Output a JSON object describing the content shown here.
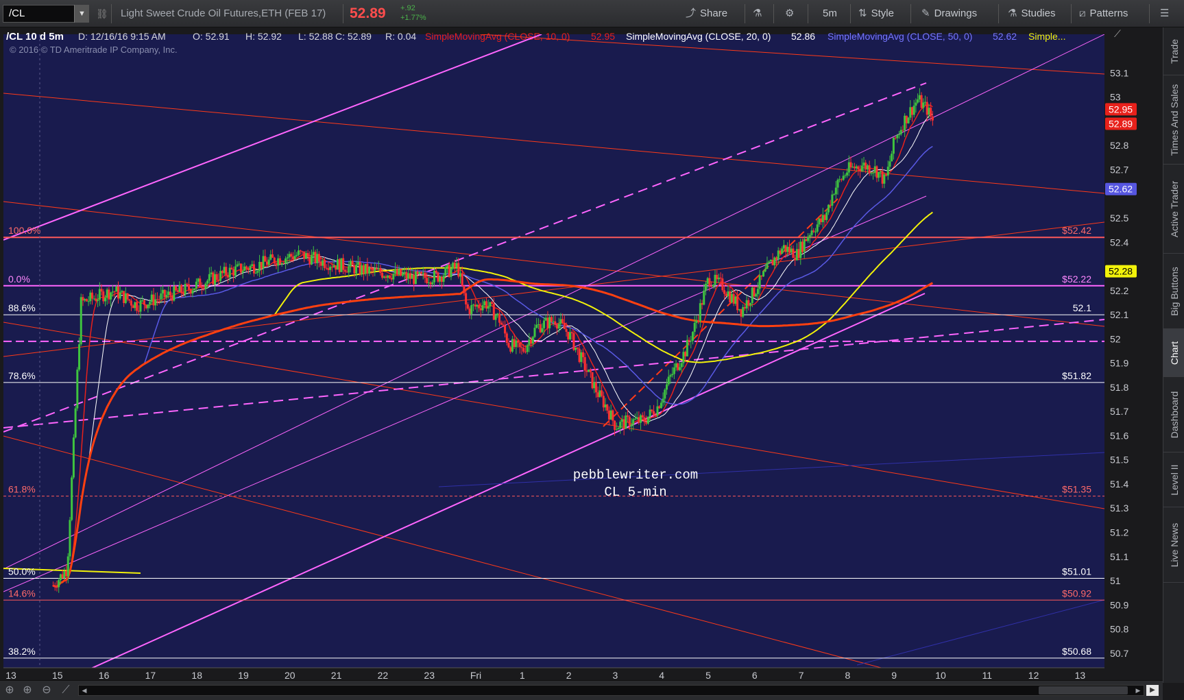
{
  "toolbar": {
    "symbol": "/CL",
    "instrument_name": "Light Sweet Crude Oil Futures,ETH (FEB 17)",
    "last_price": "52.89",
    "net_change": "+.92",
    "net_change_pct": "+1.77%",
    "buttons": {
      "share": "Share",
      "timeframe": "5m",
      "style": "Style",
      "drawings": "Drawings",
      "studies": "Studies",
      "patterns": "Patterns"
    }
  },
  "header": {
    "symbol_period": "/CL 10 d 5m",
    "date": "D: 12/16/16 9:15 AM",
    "open": "O: 52.91",
    "high": "H: 52.92",
    "low": "L: 52.88",
    "close": "C: 52.89",
    "range": "R: 0.04",
    "sma10_label": "SimpleMovingAvg (CLOSE, 10, 0)",
    "sma10_value": "52.95",
    "sma20_label": "SimpleMovingAvg (CLOSE, 20, 0)",
    "sma20_value": "52.86",
    "sma50_label": "SimpleMovingAvg (CLOSE, 50, 0)",
    "sma50_value": "52.62",
    "more": "Simple...",
    "copyright": "2016 © TD Ameritrade IP Company, Inc."
  },
  "watermark": {
    "line1": "pebblewriter.com",
    "line2": "CL 5-min"
  },
  "chart_data": {
    "type": "candlestick",
    "title": "/CL 10 d 5m",
    "xlabel": "",
    "ylabel": "",
    "ylim": [
      50.64,
      53.26
    ],
    "y_ticks": [
      53.1,
      53.0,
      52.8,
      52.7,
      52.5,
      52.4,
      52.2,
      52.1,
      52.0,
      51.9,
      51.8,
      51.7,
      51.6,
      51.5,
      51.4,
      51.3,
      51.2,
      51.1,
      51.0,
      50.9,
      50.8,
      50.7
    ],
    "y_tick_labels": [
      "53.1",
      "53",
      "52.8",
      "52.7",
      "52.5",
      "52.4",
      "52.2",
      "52.1",
      "52",
      "51.9",
      "51.8",
      "51.7",
      "51.6",
      "51.5",
      "51.4",
      "51.3",
      "51.2",
      "51.1",
      "51",
      "50.9",
      "50.8",
      "50.7"
    ],
    "x_tick_labels": [
      "13",
      "15",
      "16",
      "17",
      "18",
      "19",
      "20",
      "21",
      "22",
      "23",
      "Fri",
      "1",
      "2",
      "3",
      "4",
      "5",
      "6",
      "7",
      "8",
      "9",
      "10",
      "11",
      "12",
      "13"
    ],
    "price_tags": [
      {
        "value": 52.95,
        "label": "52.95",
        "color": "#e8211b",
        "text_color": "#ffffff"
      },
      {
        "value": 52.89,
        "label": "52.89",
        "color": "#e8211b",
        "text_color": "#ffffff"
      },
      {
        "value": 52.62,
        "label": "52.62",
        "color": "#5656e0",
        "text_color": "#ffffff"
      },
      {
        "value": 52.28,
        "label": "52.28",
        "color": "#f2f20a",
        "text_color": "#000000"
      }
    ],
    "fib_levels": [
      {
        "pct": "100.0%",
        "price": 52.42,
        "price_label": "$52.42",
        "color": "#ff5a5a"
      },
      {
        "pct": "0.0%",
        "price": 52.22,
        "price_label": "$52.22",
        "color": "#ff66ff"
      },
      {
        "pct": "88.6%",
        "price": 52.1,
        "price_label": "52.1",
        "color": "#ffffff"
      },
      {
        "pct": "78.6%",
        "price": 51.82,
        "price_label": "$51.82",
        "color": "#ffffff"
      },
      {
        "pct": "61.8%",
        "price": 51.35,
        "price_label": "$51.35",
        "color": "#ff5a5a"
      },
      {
        "pct": "50.0%",
        "price": 51.01,
        "price_label": "$51.01",
        "color": "#ffffff"
      },
      {
        "pct": "14.6%",
        "price": 50.92,
        "price_label": "$50.92",
        "color": "#ff5a5a"
      },
      {
        "pct": "38.2%",
        "price": 50.68,
        "price_label": "$50.68",
        "color": "#ffffff"
      }
    ],
    "series": [
      {
        "name": "SimpleMovingAvg (CLOSE, 10, 0)",
        "color": "#e8211b",
        "last": 52.95
      },
      {
        "name": "SimpleMovingAvg (CLOSE, 20, 0)",
        "color": "#ffffff",
        "last": 52.86
      },
      {
        "name": "SimpleMovingAvg (CLOSE, 50, 0)",
        "color": "#5a5ae6",
        "last": 52.62
      },
      {
        "name": "",
        "color": "#f2f20a",
        "last": 52.28
      },
      {
        "name": "",
        "color": "#ff4010",
        "last": 52.24
      }
    ],
    "price_path": [
      [
        0.2,
        50.98
      ],
      [
        0.5,
        51.05
      ],
      [
        0.8,
        52.15
      ],
      [
        1.5,
        52.2
      ],
      [
        2.0,
        52.14
      ],
      [
        2.5,
        52.17
      ],
      [
        3.0,
        52.2
      ],
      [
        3.5,
        52.24
      ],
      [
        4.0,
        52.28
      ],
      [
        4.5,
        52.3
      ],
      [
        5.0,
        52.33
      ],
      [
        5.5,
        52.35
      ],
      [
        6.0,
        52.32
      ],
      [
        6.5,
        52.3
      ],
      [
        7.0,
        52.28
      ],
      [
        7.5,
        52.27
      ],
      [
        8.0,
        52.25
      ],
      [
        8.5,
        52.26
      ],
      [
        8.9,
        52.3
      ],
      [
        9.1,
        52.12
      ],
      [
        9.5,
        52.15
      ],
      [
        9.8,
        52.08
      ],
      [
        10.0,
        51.98
      ],
      [
        10.3,
        51.95
      ],
      [
        10.6,
        52.05
      ],
      [
        11.0,
        52.08
      ],
      [
        11.3,
        52.02
      ],
      [
        11.6,
        51.9
      ],
      [
        11.9,
        51.78
      ],
      [
        12.1,
        51.72
      ],
      [
        12.3,
        51.64
      ],
      [
        12.6,
        51.66
      ],
      [
        12.9,
        51.66
      ],
      [
        13.2,
        51.72
      ],
      [
        13.5,
        51.85
      ],
      [
        13.8,
        51.95
      ],
      [
        14.0,
        52.05
      ],
      [
        14.3,
        52.25
      ],
      [
        14.6,
        52.22
      ],
      [
        15.0,
        52.12
      ],
      [
        15.3,
        52.2
      ],
      [
        15.6,
        52.3
      ],
      [
        15.9,
        52.38
      ],
      [
        16.2,
        52.35
      ],
      [
        16.5,
        52.45
      ],
      [
        16.8,
        52.5
      ],
      [
        17.0,
        52.62
      ],
      [
        17.3,
        52.7
      ],
      [
        17.6,
        52.72
      ],
      [
        17.9,
        52.7
      ],
      [
        18.1,
        52.65
      ],
      [
        18.3,
        52.82
      ],
      [
        18.5,
        52.9
      ],
      [
        18.8,
        52.99
      ],
      [
        19.0,
        52.95
      ],
      [
        19.15,
        52.89
      ]
    ]
  }
}
